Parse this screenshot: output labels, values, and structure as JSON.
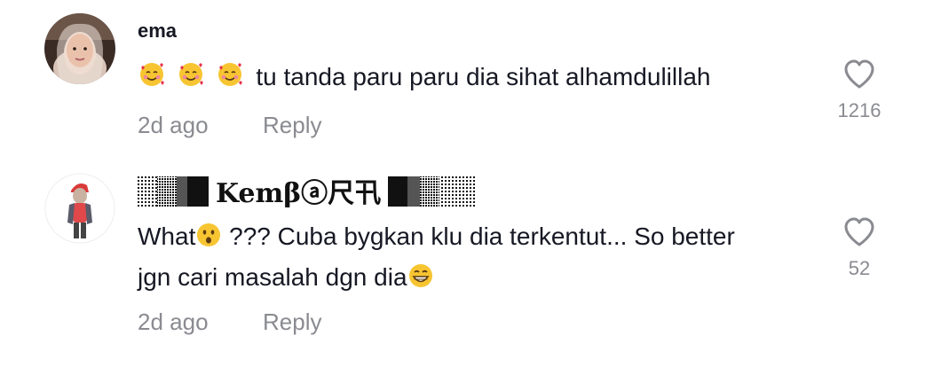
{
  "comments": [
    {
      "username": "ema",
      "text_main": "tu tanda paru paru dia sihat alhamdulillah",
      "emoji_prefix": [
        "smiling-face-with-hearts",
        "smiling-face-with-hearts",
        "smiling-face-with-hearts"
      ],
      "time": "2d ago",
      "reply": "Reply",
      "likes": "1216"
    },
    {
      "username": "Kemβⓐ尺卂",
      "text_line1_a": "What",
      "text_line1_b": " ??? Cuba bygkan klu dia terkentut... So better",
      "text_line2": "jgn cari masalah dgn dia",
      "emojis": [
        "hushed-face",
        "grinning-face"
      ],
      "time": "2d ago",
      "reply": "Reply",
      "likes": "52"
    }
  ],
  "colors": {
    "text": "#161823",
    "muted": "#8a8b91",
    "heart_outline": "#8a8b91",
    "emoji_yellow": "#f7c531",
    "emoji_heart": "#e8334a"
  }
}
